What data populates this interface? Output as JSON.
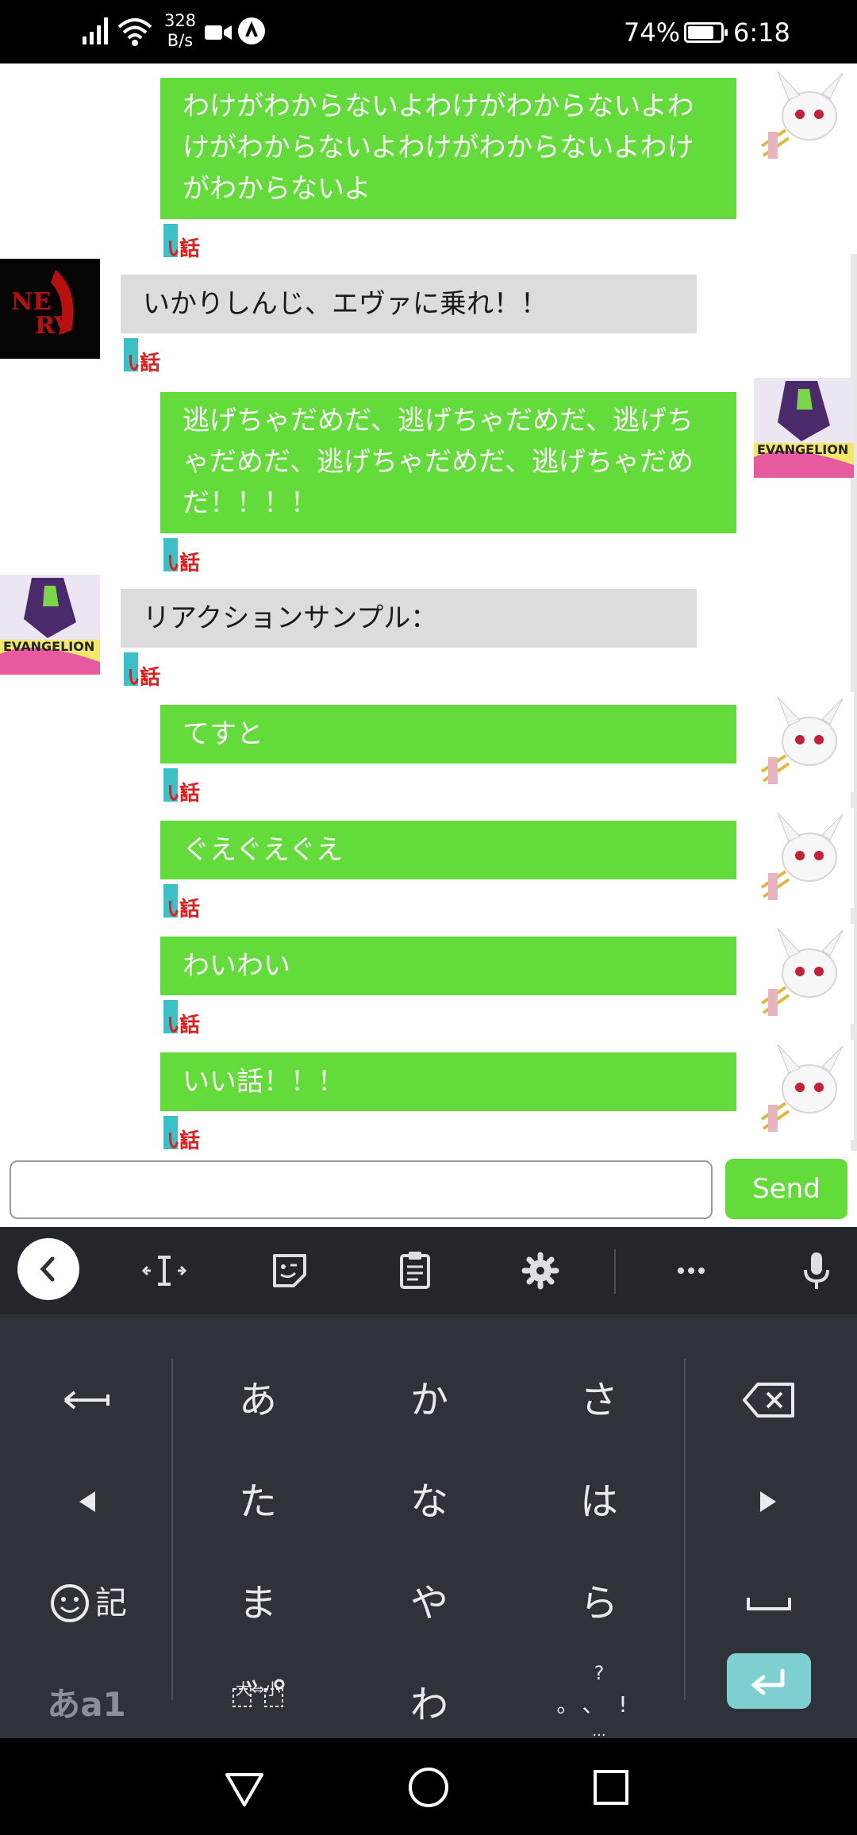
{
  "status_bar": {
    "net_speed_value": "328",
    "net_speed_unit": "B/s",
    "battery_percent": "74%",
    "time": "6:18",
    "icons": [
      "signal-icon",
      "wifi-icon",
      "video-icon",
      "a-badge-icon",
      "battery-icon"
    ]
  },
  "messages": [
    {
      "side": "mine",
      "text": "わけがわからないよわけがわからないよわけがわからないよわけがわからないよわけがわからないよ",
      "avatar": "kyubey-avatar"
    },
    {
      "side": "theirs",
      "text": "いかりしんじ、エヴァに乗れ！！",
      "avatar": "nerv-avatar",
      "avatar_text": "NERV"
    },
    {
      "side": "mine",
      "text": "逃げちゃだめだ、逃げちゃだめだ、逃げちゃだめだ、逃げちゃだめだ、逃げちゃだめだ！！！！",
      "avatar": "evangelion-avatar"
    },
    {
      "side": "theirs",
      "text": "リアクションサンプル：",
      "avatar": "evangelion-avatar"
    },
    {
      "side": "mine",
      "text": "てすと",
      "avatar": "kyubey-avatar"
    },
    {
      "side": "mine",
      "text": "ぐえぐえぐえ",
      "avatar": "kyubey-avatar"
    },
    {
      "side": "mine",
      "text": "わいわい",
      "avatar": "kyubey-avatar"
    },
    {
      "side": "mine",
      "text": "いい話！！！",
      "avatar": "kyubey-avatar"
    }
  ],
  "input": {
    "value": "",
    "send_label": "Send"
  },
  "keyboard": {
    "toolbar_icons": [
      "back-icon",
      "cursor-icon",
      "sticker-icon",
      "clipboard-icon",
      "gear-icon",
      "more-icon",
      "microphone-icon"
    ],
    "keys": {
      "a": "あ",
      "ka": "か",
      "sa": "さ",
      "ta": "た",
      "na": "な",
      "ha": "は",
      "ma": "ま",
      "ya": "や",
      "ra": "ら",
      "wa": "わ",
      "emoji_label": "記",
      "mode_label": "あa1",
      "dakuten_label": "大⇔小",
      "punct_label": "?",
      "punct_marks": "。、!",
      "punct_more": "..."
    },
    "accent_color": "#7ecfcf"
  },
  "colors": {
    "my_bubble": "#63db3a",
    "their_bubble": "#dcdcdc",
    "keyboard_bg": "#2d3339"
  }
}
